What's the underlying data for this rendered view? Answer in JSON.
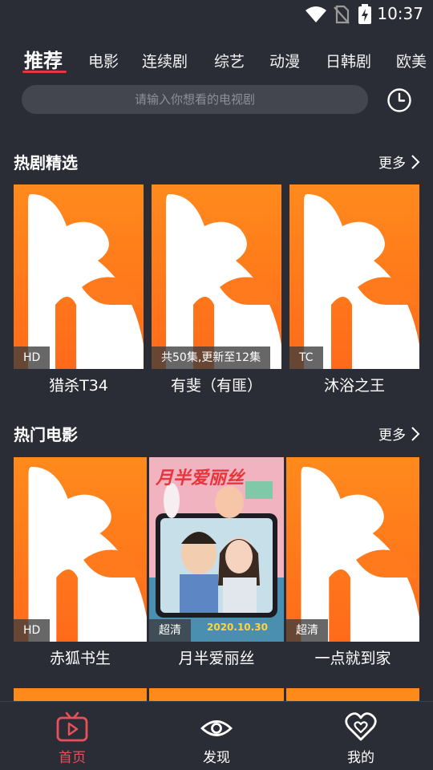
{
  "status_bar": {
    "time": "10:37",
    "icons": [
      "wifi-icon",
      "no-sim-icon",
      "battery-charging-icon"
    ]
  },
  "tabs": [
    "推荐",
    "电影",
    "连续剧",
    "综艺",
    "动漫",
    "日韩剧",
    "欧美"
  ],
  "active_tab_index": 0,
  "search": {
    "placeholder": "请输入你想看的电视剧",
    "history_icon": "clock-icon"
  },
  "sections": [
    {
      "title": "热剧精选",
      "more_label": "更多",
      "items": [
        {
          "title": "猎杀T34",
          "badge": "HD",
          "poster": "app-logo-placeholder"
        },
        {
          "title": "有斐（有匪）",
          "badge": "共50集,更新至12集",
          "poster": "app-logo-placeholder"
        },
        {
          "title": "沐浴之王",
          "badge": "TC",
          "poster": "app-logo-placeholder"
        }
      ]
    },
    {
      "title": "热门电影",
      "more_label": "更多",
      "items": [
        {
          "title": "赤狐书生",
          "badge": "HD",
          "poster": "app-logo-placeholder"
        },
        {
          "title": "月半爱丽丝",
          "badge": "超清",
          "poster": "movie-poster-image",
          "poster_title": "月半爱丽丝",
          "poster_date": "2020.10.30"
        },
        {
          "title": "一点就到家",
          "badge": "超清",
          "poster": "app-logo-placeholder"
        }
      ]
    }
  ],
  "bottom_nav": [
    {
      "label": "首页",
      "icon": "tv-home-icon",
      "active": true
    },
    {
      "label": "发现",
      "icon": "eye-icon",
      "active": false
    },
    {
      "label": "我的",
      "icon": "heart-user-icon",
      "active": false
    }
  ],
  "colors": {
    "background": "#2b2d36",
    "accent": "#e8343c",
    "poster_orange": "#ff7a1c",
    "search_bg": "#43464f"
  }
}
